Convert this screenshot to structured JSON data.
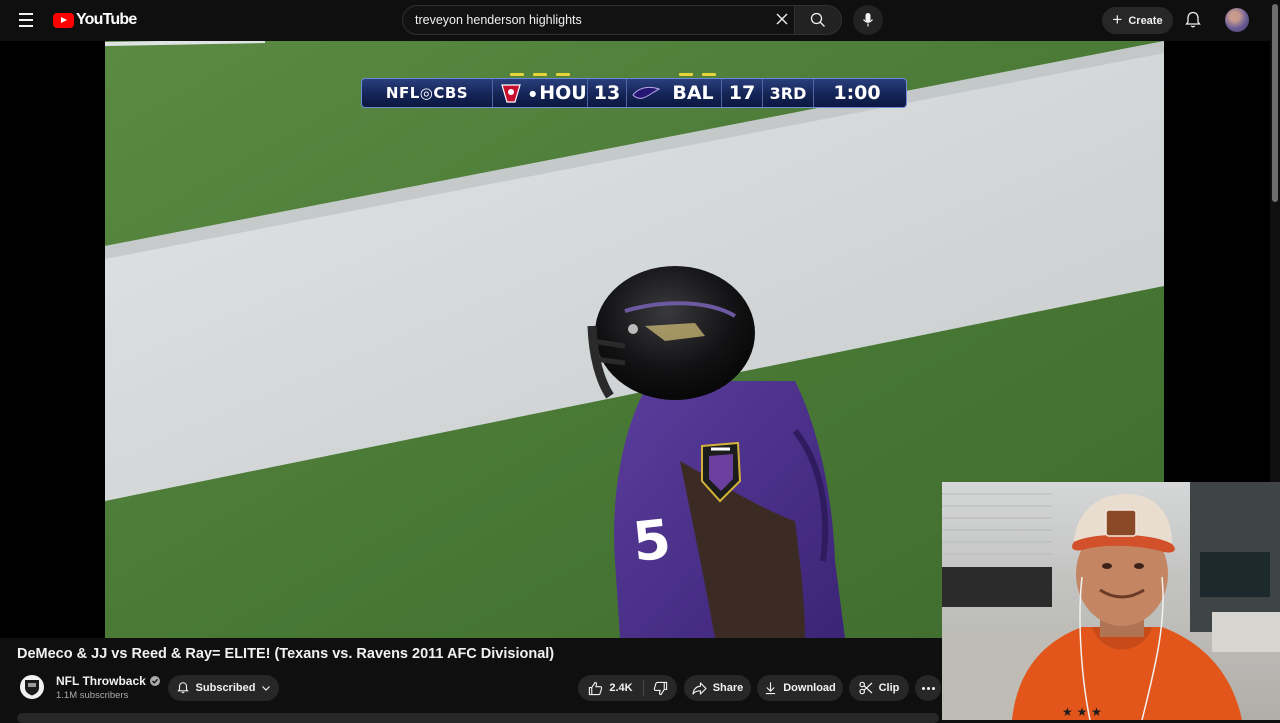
{
  "header": {
    "logo_text": "YouTube",
    "search_value": "treveyon henderson highlights",
    "create_label": "Create"
  },
  "scorebug": {
    "network": "NFL◎CBS",
    "home_team": "HOU",
    "home_score": "13",
    "away_team": "BAL",
    "away_score": "17",
    "quarter": "3RD",
    "clock": "1:00"
  },
  "video": {
    "title": "DeMeco & JJ vs Reed & Ray= ELITE! (Texans vs. Ravens 2011 AFC Divisional)"
  },
  "channel": {
    "name": "NFL Throwback",
    "subscribers": "1.1M subscribers",
    "subscribe_label": "Subscribed"
  },
  "actions": {
    "like_count": "2.4K",
    "share_label": "Share",
    "download_label": "Download",
    "clip_label": "Clip"
  },
  "colors": {
    "background": "#0f0f0f",
    "button_bg": "#272727",
    "brand_red": "#ff0000",
    "field_green": "#4b7a35",
    "scorebug_blue": "#142456"
  },
  "icons": [
    "menu-icon",
    "youtube-logo-icon",
    "close-icon",
    "search-icon",
    "mic-icon",
    "plus-icon",
    "bell-icon",
    "verified-icon",
    "bell-subscribed-icon",
    "chevron-down-icon",
    "thumb-up-icon",
    "thumb-down-icon",
    "share-icon",
    "download-icon",
    "scissors-icon",
    "more-horiz-icon"
  ]
}
